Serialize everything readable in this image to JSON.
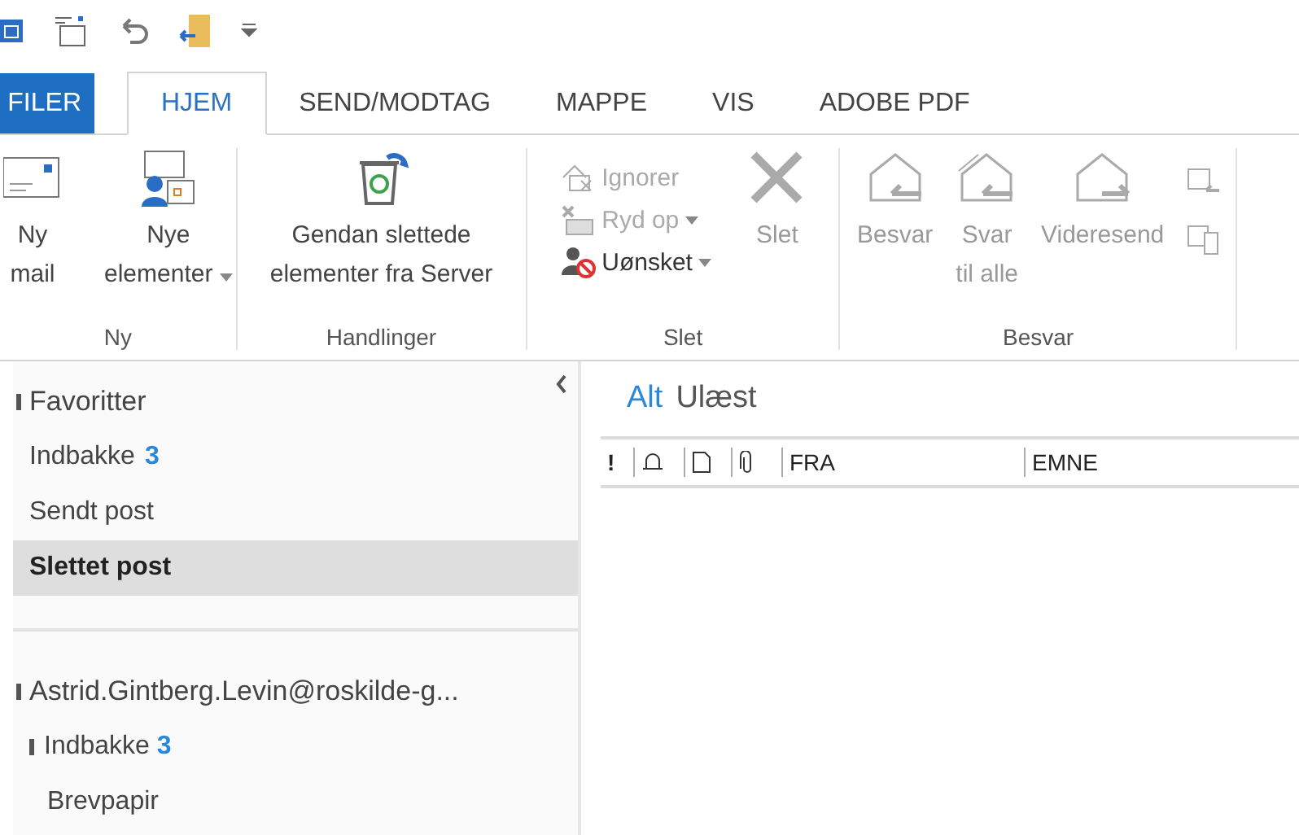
{
  "tabs": [
    {
      "label": "FILER",
      "kind": "file",
      "selected": false
    },
    {
      "label": "HJEM",
      "kind": "tab",
      "selected": true
    },
    {
      "label": "SEND/MODTAG",
      "kind": "tab",
      "selected": false
    },
    {
      "label": "MAPPE",
      "kind": "tab",
      "selected": false
    },
    {
      "label": "VIS",
      "kind": "tab",
      "selected": false
    },
    {
      "label": "ADOBE PDF",
      "kind": "tab",
      "selected": false
    }
  ],
  "ribbon": {
    "groups": [
      {
        "label": "Ny",
        "buttons": [
          {
            "kind": "large",
            "lines": [
              "Ny",
              "mail"
            ],
            "dropdown": false,
            "disabled": false
          },
          {
            "kind": "large",
            "lines": [
              "Nye",
              "elementer"
            ],
            "dropdown": true,
            "disabled": false
          }
        ]
      },
      {
        "label": "Handlinger",
        "buttons": [
          {
            "kind": "large",
            "lines": [
              "Gendan slettede",
              "elementer fra Server"
            ],
            "dropdown": false,
            "disabled": false
          }
        ]
      },
      {
        "label": "Slet",
        "buttons": [
          {
            "kind": "stack",
            "items": [
              {
                "label": "Ignorer",
                "dropdown": false,
                "disabled": true
              },
              {
                "label": "Ryd op",
                "dropdown": true,
                "disabled": true
              },
              {
                "label": "Uønsket",
                "dropdown": true,
                "disabled": false
              }
            ]
          },
          {
            "kind": "large",
            "lines": [
              "Slet"
            ],
            "dropdown": false,
            "disabled": true
          }
        ]
      },
      {
        "label": "Besvar",
        "buttons": [
          {
            "kind": "large",
            "lines": [
              "Besvar"
            ],
            "dropdown": false,
            "disabled": true
          },
          {
            "kind": "large",
            "lines": [
              "Svar",
              "til alle"
            ],
            "dropdown": false,
            "disabled": true
          },
          {
            "kind": "large",
            "lines": [
              "Videresend"
            ],
            "dropdown": false,
            "disabled": true
          },
          {
            "kind": "icons"
          }
        ]
      }
    ]
  },
  "favorites": {
    "label": "Favoritter",
    "items": [
      {
        "label": "Indbakke",
        "count": "3",
        "selected": false
      },
      {
        "label": "Sendt post",
        "selected": false
      },
      {
        "label": "Slettet post",
        "selected": true
      }
    ]
  },
  "account": {
    "label": "Astrid.Gintberg.Levin@roskilde-g...",
    "children": [
      {
        "label": "Indbakke",
        "count": "3",
        "children": [
          {
            "label": "Brevpapir"
          }
        ]
      }
    ]
  },
  "filters": [
    {
      "label": "Alt",
      "selected": true
    },
    {
      "label": "Ulæst",
      "selected": false
    }
  ],
  "columns": [
    {
      "kind": "text",
      "label": "!"
    },
    {
      "kind": "bell"
    },
    {
      "kind": "doc"
    },
    {
      "kind": "clip"
    },
    {
      "kind": "text",
      "label": "FRA"
    },
    {
      "kind": "text",
      "label": "EMNE"
    }
  ]
}
